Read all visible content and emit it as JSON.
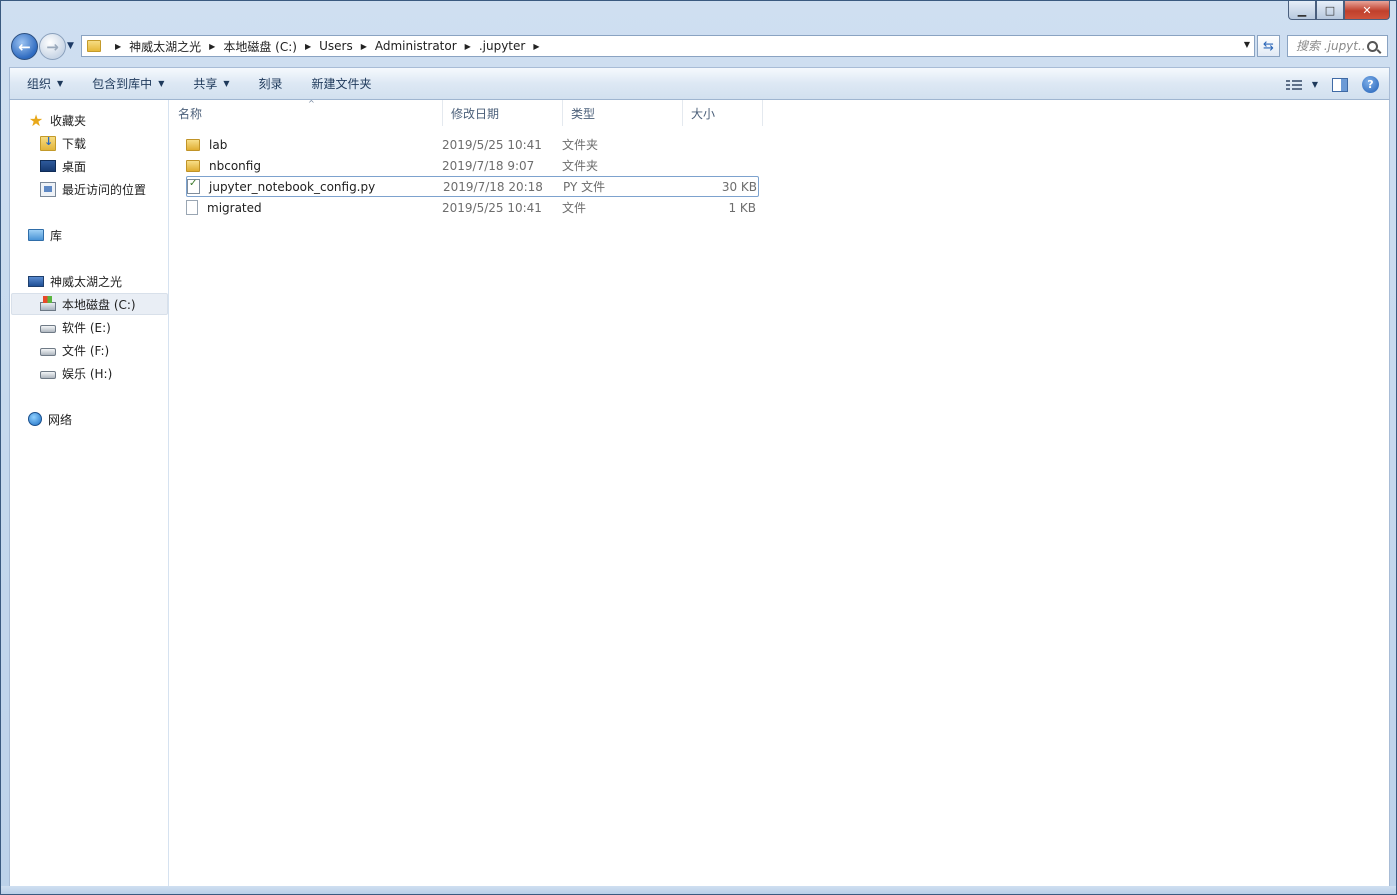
{
  "window": {
    "caption": {
      "minimize": "▁",
      "maximize": "□",
      "close": "✕"
    }
  },
  "address": {
    "crumbs": [
      "神威太湖之光",
      "本地磁盘 (C:)",
      "Users",
      "Administrator",
      ".jupyter"
    ],
    "search_placeholder": "搜索 .jupyt..."
  },
  "toolbar": {
    "organize": "组织",
    "include_in_library": "包含到库中",
    "share": "共享",
    "burn": "刻录",
    "new_folder": "新建文件夹"
  },
  "sidebar": {
    "favorites": "收藏夹",
    "downloads": "下载",
    "desktop": "桌面",
    "recent": "最近访问的位置",
    "libraries": "库",
    "computer": "神威太湖之光",
    "drive_c": "本地磁盘 (C:)",
    "drive_e": "软件 (E:)",
    "drive_f": "文件 (F:)",
    "drive_h": "娱乐 (H:)",
    "network": "网络"
  },
  "columns": {
    "name": "名称",
    "date": "修改日期",
    "type": "类型",
    "size": "大小"
  },
  "files": [
    {
      "name": "lab",
      "date": "2019/5/25 10:41",
      "type": "文件夹",
      "size": "",
      "icon": "folder-icon"
    },
    {
      "name": "nbconfig",
      "date": "2019/7/18 9:07",
      "type": "文件夹",
      "size": "",
      "icon": "folder-icon"
    },
    {
      "name": "jupyter_notebook_config.py",
      "date": "2019/7/18 20:18",
      "type": "PY 文件",
      "size": "30 KB",
      "icon": "python-file-icon"
    },
    {
      "name": "migrated",
      "date": "2019/5/25 10:41",
      "type": "文件",
      "size": "1 KB",
      "icon": "blank-file-icon"
    }
  ]
}
